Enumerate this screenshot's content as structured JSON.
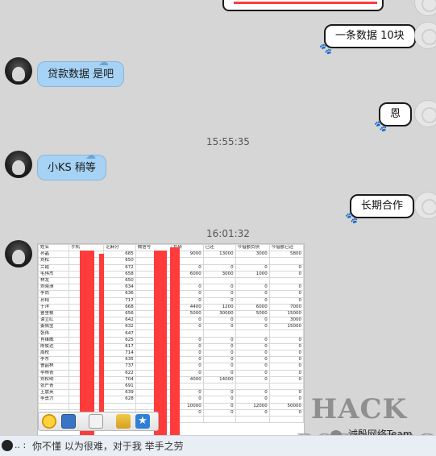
{
  "messages": {
    "out_1": "一条数据 10块",
    "in_1": "贷款数据 是吧",
    "out_2": "恩",
    "time_1": "15:55:35",
    "in_2": "小KS   稍等",
    "out_3": "长期合作",
    "time_2": "16:01:32"
  },
  "sheet": {
    "headers": [
      "姓名",
      "手机",
      "芝麻分",
      "微信号",
      "负债",
      "已还",
      "今借额负债",
      "今借额已还"
    ],
    "rows": [
      [
        "孙晶",
        "",
        "685",
        "",
        "9000",
        "13000",
        "3000",
        "5800"
      ],
      [
        "刘松",
        "",
        "650",
        "",
        "",
        "",
        "",
        ""
      ],
      [
        "兰霞",
        "",
        "672",
        "",
        "0",
        "0",
        "0",
        "0"
      ],
      [
        "毛伟杰",
        "",
        "658",
        "",
        "6000",
        "3000",
        "1000",
        "0"
      ],
      [
        "林龙",
        "",
        "650",
        "",
        "",
        "",
        "",
        ""
      ],
      [
        "刘晓洲",
        "",
        "634",
        "",
        "0",
        "0",
        "0",
        "0"
      ],
      [
        "李尚",
        "",
        "636",
        "",
        "0",
        "0",
        "0",
        "0"
      ],
      [
        "孙翔",
        "",
        "717",
        "",
        "0",
        "0",
        "0",
        "0"
      ],
      [
        "于洋",
        "",
        "668",
        "",
        "4400",
        "1200",
        "6000",
        "7000"
      ],
      [
        "曹里根",
        "",
        "656",
        "",
        "5000",
        "30000",
        "5000",
        "15000"
      ],
      [
        "谭立红",
        "",
        "642",
        "",
        "0",
        "0",
        "0",
        "3000"
      ],
      [
        "姜佩莹",
        "",
        "632",
        "",
        "0",
        "0",
        "0",
        "15000"
      ],
      [
        "张伟",
        "",
        "647",
        "",
        "",
        "",
        "",
        ""
      ],
      [
        "肖维威",
        "",
        "625",
        "",
        "0",
        "0",
        "0",
        "0"
      ],
      [
        "陈俊达",
        "",
        "617",
        "",
        "0",
        "0",
        "0",
        "0"
      ],
      [
        "周校",
        "",
        "714",
        "",
        "0",
        "0",
        "0",
        "0"
      ],
      [
        "李东",
        "",
        "635",
        "",
        "0",
        "0",
        "0",
        "0"
      ],
      [
        "曹韶林",
        "",
        "737",
        "",
        "0",
        "0",
        "0",
        "0"
      ],
      [
        "李林青",
        "",
        "622",
        "",
        "0",
        "0",
        "0",
        "0"
      ],
      [
        "刘松明",
        "",
        "704",
        "",
        "4000",
        "14000",
        "0",
        "0"
      ],
      [
        "张严青",
        "",
        "691",
        "",
        "",
        "",
        "",
        ""
      ],
      [
        "王震英",
        "",
        "639",
        "",
        "0",
        "0",
        "0",
        "0"
      ],
      [
        "李勇力",
        "",
        "628",
        "",
        "0",
        "0",
        "0",
        "0"
      ],
      [
        "",
        "",
        "",
        "",
        "10000",
        "0",
        "12000",
        "50000"
      ],
      [
        "",
        "",
        "",
        "",
        "0",
        "0",
        "0",
        "0"
      ],
      [
        "资源",
        "",
        "",
        "",
        "",
        "",
        "",
        ""
      ]
    ]
  },
  "watermark": {
    "line1": "HACK",
    "line2": "DOOR.ORG",
    "account": "诚殷网络Team"
  },
  "status_bar": {
    "text": "你不懂 以为很难，对于我 举手之劳",
    "prefix": ".. :"
  }
}
